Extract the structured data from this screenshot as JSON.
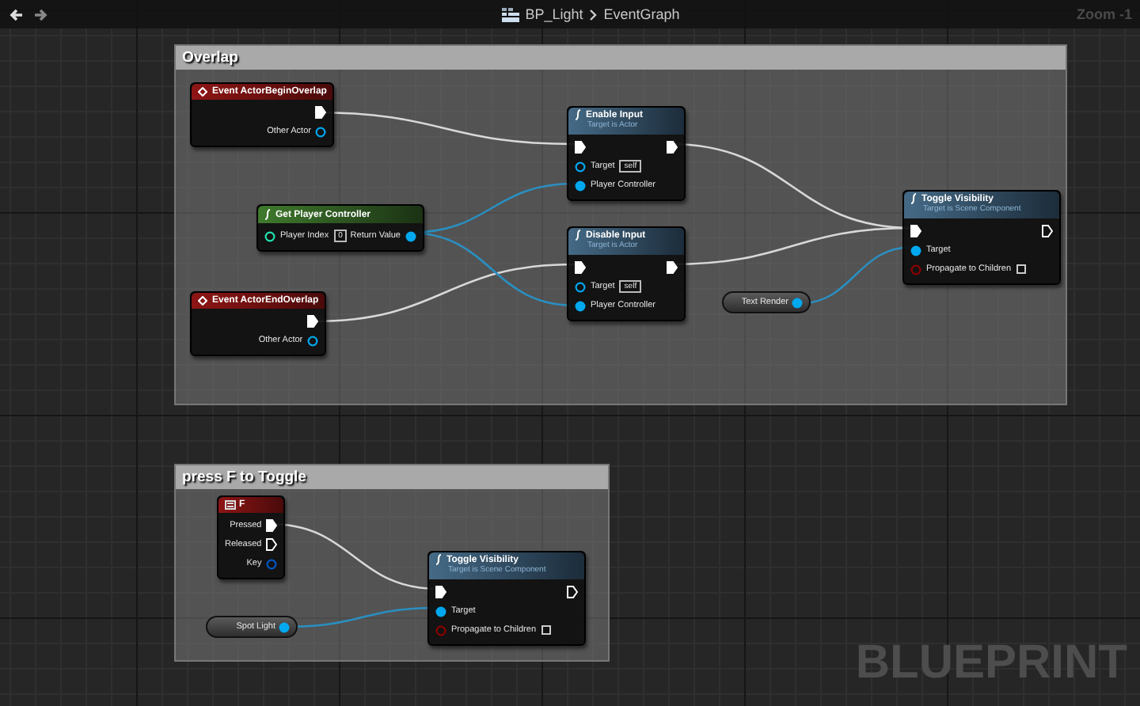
{
  "toolbar": {
    "breadcrumb": [
      {
        "label": "BP_Light"
      },
      {
        "label": "EventGraph"
      }
    ],
    "zoom": "Zoom -1"
  },
  "comments": [
    {
      "title": "Overlap"
    },
    {
      "title": "press F to Toggle"
    }
  ],
  "nodes": [
    {
      "kind": "event",
      "title": "Event ActorBeginOverlap",
      "rows": [
        {
          "right": {
            "kind": "exec",
            "connected": true
          }
        },
        {
          "right": {
            "kind": "object",
            "label": "Other Actor",
            "connected": false
          }
        }
      ]
    },
    {
      "kind": "pure",
      "title": "Get Player Controller",
      "rows": [
        {
          "left": {
            "kind": "int",
            "label": "Player Index",
            "value": "0",
            "connected": false
          },
          "right": {
            "kind": "object",
            "label": "Return Value",
            "connected": true
          }
        }
      ]
    },
    {
      "kind": "event",
      "title": "Event ActorEndOverlap",
      "rows": [
        {
          "right": {
            "kind": "exec",
            "connected": true
          }
        },
        {
          "right": {
            "kind": "object",
            "label": "Other Actor",
            "connected": false
          }
        }
      ]
    },
    {
      "kind": "function",
      "title": "Enable Input",
      "subtitle": "Target is Actor",
      "rows": [
        {
          "left": {
            "kind": "exec",
            "connected": true
          },
          "right": {
            "kind": "exec",
            "connected": true
          }
        },
        {
          "left": {
            "kind": "object",
            "label": "Target",
            "value": "self",
            "connected": false
          }
        },
        {
          "left": {
            "kind": "object",
            "label": "Player Controller",
            "connected": true
          }
        }
      ]
    },
    {
      "kind": "function",
      "title": "Disable Input",
      "subtitle": "Target is Actor",
      "rows": [
        {
          "left": {
            "kind": "exec",
            "connected": true
          },
          "right": {
            "kind": "exec",
            "connected": true
          }
        },
        {
          "left": {
            "kind": "object",
            "label": "Target",
            "value": "self",
            "connected": false
          }
        },
        {
          "left": {
            "kind": "object",
            "label": "Player Controller",
            "connected": true
          }
        }
      ]
    },
    {
      "kind": "variable",
      "title": "Text Render",
      "pin": {
        "kind": "object",
        "connected": true
      }
    },
    {
      "kind": "function",
      "title": "Toggle Visibility",
      "subtitle": "Target is Scene Component",
      "rows": [
        {
          "left": {
            "kind": "exec",
            "connected": true
          },
          "right": {
            "kind": "exec",
            "connected": false
          }
        },
        {
          "left": {
            "kind": "object",
            "label": "Target",
            "connected": true
          }
        },
        {
          "left": {
            "kind": "bool",
            "label": "Propagate to Children",
            "connected": false,
            "checked": false
          }
        }
      ]
    },
    {
      "kind": "key",
      "title": "F",
      "rows": [
        {
          "right": {
            "kind": "exec",
            "label": "Pressed",
            "connected": true
          }
        },
        {
          "right": {
            "kind": "exec",
            "label": "Released",
            "connected": false
          }
        },
        {
          "right": {
            "kind": "struct",
            "label": "Key",
            "connected": false
          }
        }
      ]
    },
    {
      "kind": "variable",
      "title": "Spot Light",
      "pin": {
        "kind": "object",
        "connected": true
      }
    },
    {
      "kind": "function",
      "title": "Toggle Visibility",
      "subtitle": "Target is Scene Component",
      "rows": [
        {
          "left": {
            "kind": "exec",
            "connected": true
          },
          "right": {
            "kind": "exec",
            "connected": false
          }
        },
        {
          "left": {
            "kind": "object",
            "label": "Target",
            "connected": true
          }
        },
        {
          "left": {
            "kind": "bool",
            "label": "Propagate to Children",
            "connected": false,
            "checked": false
          }
        }
      ]
    }
  ],
  "watermark": "BLUEPRINT"
}
